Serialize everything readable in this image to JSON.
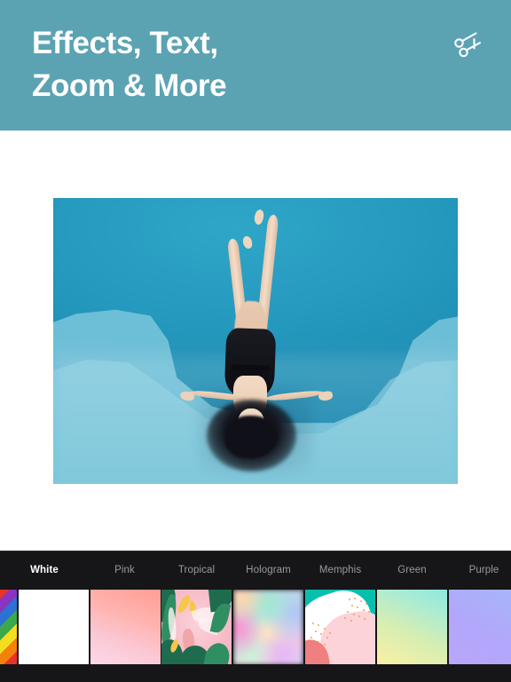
{
  "header": {
    "title": "Effects, Text,\nZoom & More",
    "background_color": "#5ba3b3",
    "text_color": "#ffffff",
    "action_icon": "scissors-icon"
  },
  "canvas": {
    "background_color": "#ffffff",
    "photo": {
      "alt": "Woman in black swimsuit floating face-up in a blue swimming pool, legs raised",
      "dominant_color": "#1f93b9"
    }
  },
  "filter_bar": {
    "background_color": "#161618",
    "active_tab": "White",
    "tabs": [
      {
        "label": "White",
        "active": true
      },
      {
        "label": "Pink",
        "active": false
      },
      {
        "label": "Tropical",
        "active": false
      },
      {
        "label": "Hologram",
        "active": false
      },
      {
        "label": "Memphis",
        "active": false
      },
      {
        "label": "Green",
        "active": false
      },
      {
        "label": "Purple",
        "active": false
      }
    ],
    "thumbnails": [
      {
        "name": "rainbow",
        "kind": "stripes",
        "partial": true
      },
      {
        "name": "white",
        "kind": "solid",
        "color": "#ffffff"
      },
      {
        "name": "pink",
        "kind": "gradient",
        "colors": [
          "#ff9d93",
          "#fcd9e8"
        ]
      },
      {
        "name": "tropical",
        "kind": "pattern",
        "colors": [
          "#f6bcc8",
          "#1f6b4e",
          "#f7c64a"
        ]
      },
      {
        "name": "hologram",
        "kind": "gradient",
        "colors": [
          "#d4c2f2",
          "#bfe8dd",
          "#f7c9e5"
        ]
      },
      {
        "name": "memphis",
        "kind": "pattern",
        "colors": [
          "#07bfae",
          "#fbd3d9",
          "#f07f7f"
        ]
      },
      {
        "name": "green",
        "kind": "gradient",
        "colors": [
          "#fbf0a4",
          "#8de8e0"
        ]
      },
      {
        "name": "purple",
        "kind": "gradient",
        "colors": [
          "#bba6fb",
          "#a6b6fa"
        ]
      }
    ]
  }
}
